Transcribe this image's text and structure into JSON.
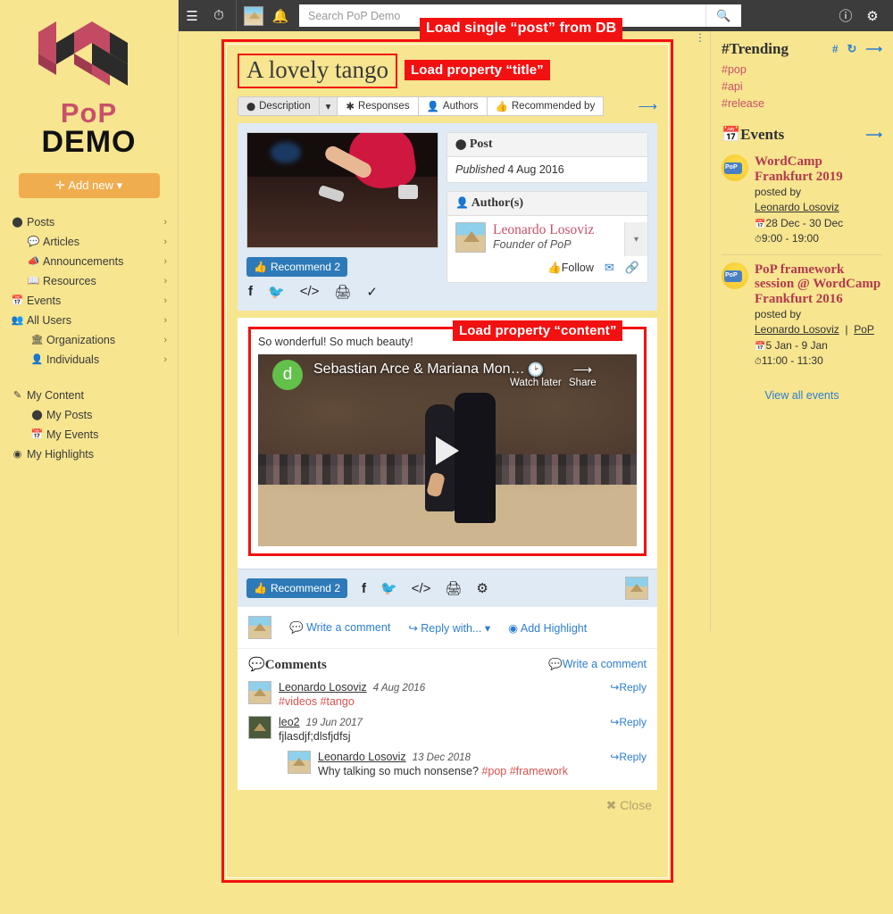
{
  "topbar": {
    "menu_icon": "hamburger-icon",
    "history_icon": "clock-icon",
    "avatar_icon": "user-avatar-thumb",
    "notifications_icon": "bell-icon",
    "search_placeholder": "Search PoP Demo",
    "search_value": "",
    "search_button_icon": "search-icon",
    "info_icon": "info-icon",
    "settings_icon": "gear-icon"
  },
  "annotations": {
    "load_post": "Load single “post” from DB",
    "load_title": "Load property “title”",
    "load_content": "Load property “content”",
    "color": "#f21111"
  },
  "sidebar": {
    "logo_top": "PoP",
    "logo_bottom": "DEMO",
    "add_new": "Add new",
    "items": [
      {
        "label": "Posts",
        "icon": "circle-icon",
        "level": 0,
        "chevron": "›"
      },
      {
        "label": "Articles",
        "icon": "comment-icon",
        "level": 1,
        "chevron": "›"
      },
      {
        "label": "Announcements",
        "icon": "megaphone-icon",
        "level": 1,
        "chevron": "›"
      },
      {
        "label": "Resources",
        "icon": "book-icon",
        "level": 1,
        "chevron": "›"
      },
      {
        "label": "Events",
        "icon": "calendar-icon",
        "level": 0,
        "chevron": "›"
      },
      {
        "label": "All Users",
        "icon": "users-icon",
        "level": 0,
        "chevron": "›"
      },
      {
        "label": "Organizations",
        "icon": "bank-icon",
        "level": 1,
        "chevron": "›"
      },
      {
        "label": "Individuals",
        "icon": "person-icon",
        "level": 1,
        "chevron": "›"
      }
    ],
    "items2": [
      {
        "label": "My Content",
        "icon": "edit-icon",
        "level": 0,
        "chevron": ""
      },
      {
        "label": "My Posts",
        "icon": "circle-icon",
        "level": 1,
        "chevron": ""
      },
      {
        "label": "My Events",
        "icon": "calendar-icon",
        "level": 1,
        "chevron": ""
      },
      {
        "label": "My Highlights",
        "icon": "target-icon",
        "level": 0,
        "chevron": ""
      }
    ]
  },
  "post": {
    "title": "A lovely tango",
    "tabs": [
      {
        "label": "Description",
        "icon": "circle-icon",
        "active": true
      },
      {
        "label": "Responses",
        "icon": "asterisk-icon",
        "active": false
      },
      {
        "label": "Authors",
        "icon": "person-icon",
        "active": false
      },
      {
        "label": "Recommended by",
        "icon": "thumbs-up-icon",
        "active": false
      }
    ],
    "share_icon": "share-arrow-icon",
    "featured_image_alt": "tango-dancer-feet-photo",
    "meta_card": {
      "heading": "Post",
      "heading_icon": "circle-icon",
      "published_label": "Published",
      "published_date": "4 Aug 2016"
    },
    "authors_card": {
      "heading": "Author(s)",
      "heading_icon": "person-icon",
      "author_name": "Leonardo Losoviz",
      "author_role": "Founder of PoP",
      "follow_label": "Follow",
      "follow_icon": "thumbs-up-icon",
      "email_icon": "envelope-icon",
      "link_icon": "link-icon",
      "caret_icon": "chevron-down-icon"
    },
    "recommend_label": "Recommend 2",
    "recommend_icon": "thumbs-up-icon",
    "share_icons_top": [
      "facebook-icon",
      "twitter-icon",
      "code-icon",
      "print-icon",
      "flame-icon"
    ],
    "content_text": "So wonderful! So much beauty!",
    "video": {
      "channel_letter": "d",
      "title": "Sebastian Arce & Mariana Mon…",
      "watch_later": "Watch later",
      "watch_later_icon": "clock-icon",
      "share": "Share",
      "share_icon": "share-arrow-icon",
      "play_icon": "play-icon"
    },
    "action_bar": {
      "recommend_label": "Recommend 2",
      "icons": [
        "facebook-icon",
        "twitter-icon",
        "code-icon",
        "print-icon",
        "gear-icon"
      ],
      "avatar_icon": "user-avatar-thumb"
    },
    "comment_bar": {
      "write_comment": "Write a comment",
      "write_comment_icon": "comment-icon",
      "reply_with": "Reply with...",
      "reply_with_icon": "reply-arrow-icon",
      "add_highlight": "Add Highlight",
      "add_highlight_icon": "target-icon"
    },
    "comments_section": {
      "heading": "Comments",
      "heading_icon": "comment-icon",
      "write_comment": "Write a comment",
      "reply_label": "Reply",
      "reply_icon": "reply-arrow-icon",
      "items": [
        {
          "user": "Leonardo Losoviz",
          "date": "4 Aug 2016",
          "text": "",
          "tags": "#videos #tango",
          "nested": false
        },
        {
          "user": "leo2",
          "date": "19 Jun 2017",
          "text": "fjlasdjf;dlsfjdfsj",
          "tags": "",
          "nested": false
        },
        {
          "user": "Leonardo Losoviz",
          "date": "13 Dec 2018",
          "text": "Why talking so much nonsense? ",
          "tags": "#pop #framework",
          "nested": true
        }
      ]
    },
    "close_label": "Close",
    "close_icon": "close-x-icon"
  },
  "right": {
    "trending": {
      "heading": "Trending",
      "heading_icon": "hashtag-icon",
      "actions": [
        "hashtag-icon",
        "refresh-icon",
        "share-arrow-icon"
      ],
      "tags": [
        "#pop",
        "#api",
        "#release"
      ]
    },
    "events": {
      "heading": "Events",
      "heading_icon": "calendar-icon",
      "action_icon": "share-arrow-icon",
      "posted_by": "posted by",
      "items": [
        {
          "title": "WordCamp Frankfurt 2019",
          "author": "Leonardo Losoviz",
          "org": "",
          "dates": "28 Dec - 30 Dec",
          "times": "9:00 - 19:00"
        },
        {
          "title": "PoP framework session @ WordCamp Frankfurt 2016",
          "author": "Leonardo Losoviz",
          "org": "PoP",
          "dates": "5 Jan - 9 Jan",
          "times": "11:00 - 11:30"
        }
      ],
      "view_all": "View all events"
    },
    "dots_icon": "vertical-dots-icon"
  }
}
